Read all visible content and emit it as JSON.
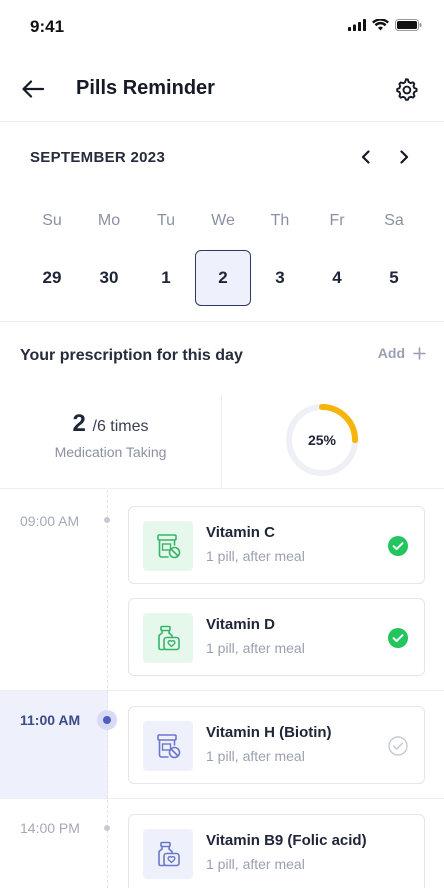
{
  "status": {
    "time": "9:41"
  },
  "header": {
    "title": "Pills Reminder"
  },
  "calendar": {
    "month": "SEPTEMBER 2023",
    "weekdays": [
      "Su",
      "Mo",
      "Tu",
      "We",
      "Th",
      "Fr",
      "Sa"
    ],
    "dates": [
      "29",
      "30",
      "1",
      "2",
      "3",
      "4",
      "5"
    ],
    "selected_date": "2"
  },
  "prescription": {
    "title": "Your prescription for this day",
    "add_label": "Add",
    "taken_count": "2",
    "taken_total": "/6 times",
    "caption": "Medication Taking",
    "progress_label": "25%",
    "progress_fraction": 0.25
  },
  "colors": {
    "accent": "#2c3a66",
    "progress": "#f5b50a",
    "done": "#22c55e",
    "active_slot": "#eef0fb"
  },
  "schedule": [
    {
      "time": "09:00 AM"
    },
    {
      "time": "11:00 AM"
    },
    {
      "time": "14:00 PM"
    }
  ],
  "medications": [
    {
      "name": "Vitamin C",
      "dose": "1 pill, after meal",
      "icon": "pill-bottle-icon",
      "status": "taken"
    },
    {
      "name": "Vitamin D",
      "dose": "1 pill, after meal",
      "icon": "supplement-jar-icon",
      "status": "taken"
    },
    {
      "name": "Vitamin H (Biotin)",
      "dose": "1 pill, after meal",
      "icon": "pill-bottle-icon",
      "status": "pending"
    },
    {
      "name": "Vitamin B9 (Folic acid)",
      "dose": "1 pill, after meal",
      "icon": "supplement-jar-icon",
      "status": "pending"
    }
  ]
}
